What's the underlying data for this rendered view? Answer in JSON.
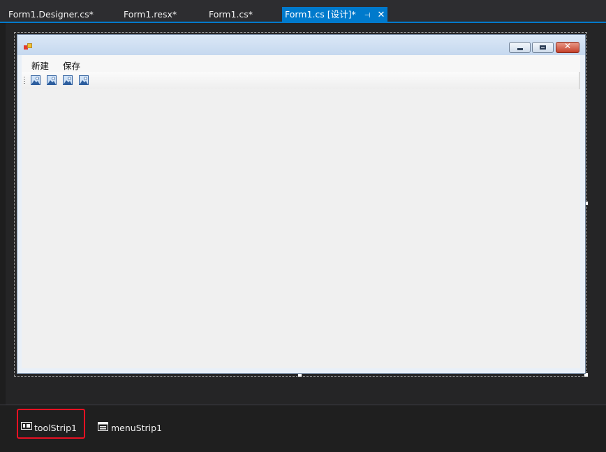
{
  "tabs": [
    {
      "label": "Form1.Designer.cs*"
    },
    {
      "label": "Form1.resx*"
    },
    {
      "label": "Form1.cs*"
    },
    {
      "label": "Form1.cs [设计]*",
      "active": true,
      "pin_icon": "pin-icon",
      "close_icon": "close-icon"
    }
  ],
  "form": {
    "icon": "form-icon",
    "caption_buttons": [
      "minimize-icon",
      "maximize-icon",
      "close-icon"
    ],
    "close_glyph": "✕",
    "menu": [
      "新建",
      "保存"
    ],
    "toolstrip_buttons": [
      "image-icon",
      "image-icon",
      "image-icon",
      "image-icon"
    ]
  },
  "tray": {
    "items": [
      {
        "label": "toolStrip1",
        "icon": "toolstrip-icon",
        "highlighted": true
      },
      {
        "label": "menuStrip1",
        "icon": "menustrip-icon"
      }
    ]
  },
  "colors": {
    "accent": "#007acc",
    "highlight": "#e81123",
    "form_client": "#f0f0f0"
  }
}
